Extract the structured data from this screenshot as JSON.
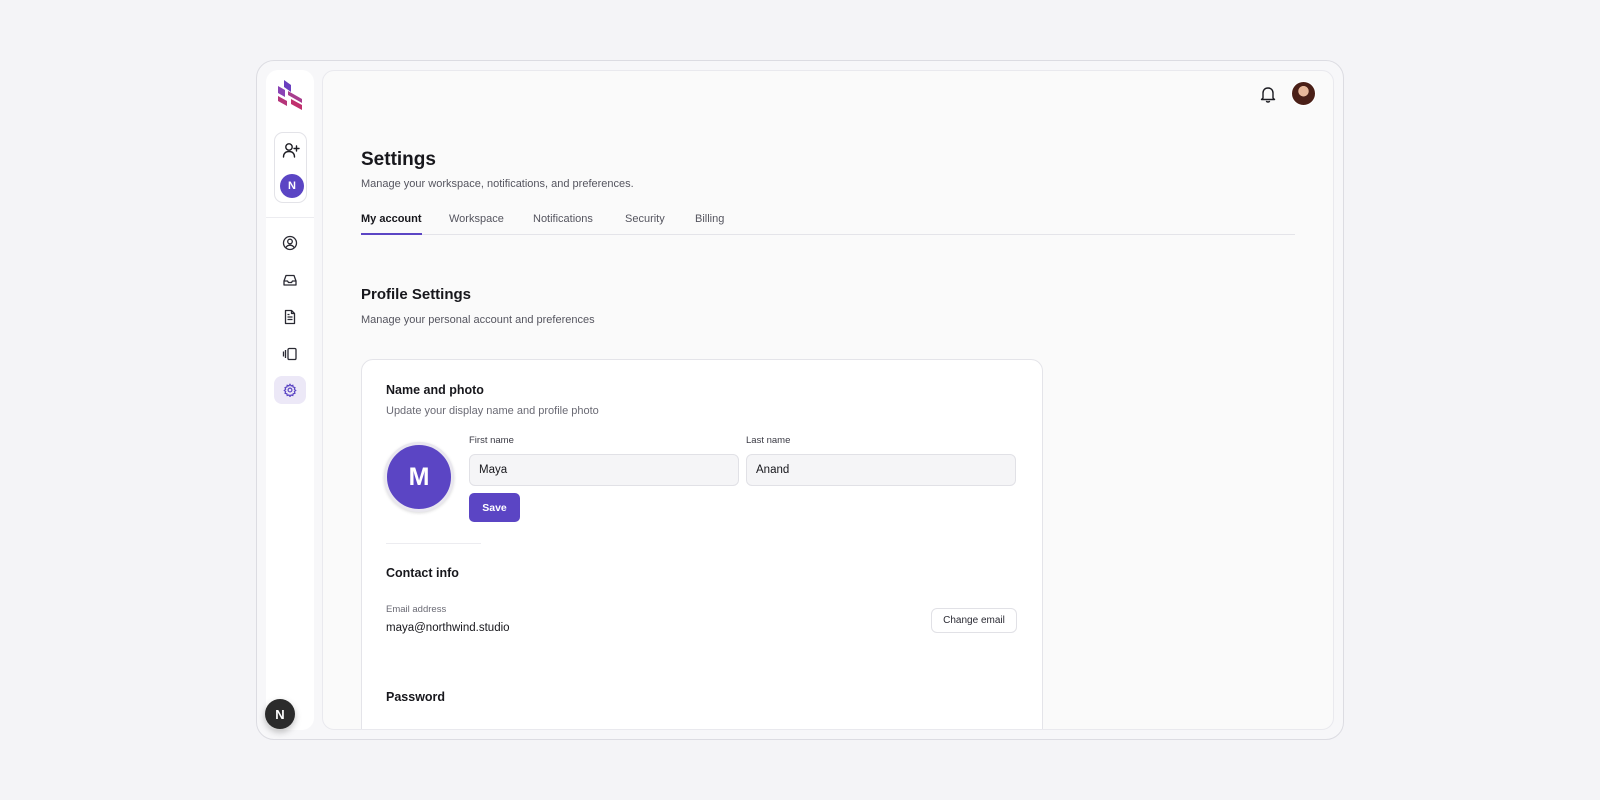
{
  "sidebar": {
    "workspace_initial": "N",
    "bottom_badge": "N",
    "nav": [
      {
        "icon": "user-circle-icon",
        "active": false
      },
      {
        "icon": "inbox-icon",
        "active": false
      },
      {
        "icon": "document-icon",
        "active": false
      },
      {
        "icon": "gallery-icon",
        "active": false
      },
      {
        "icon": "gear-icon",
        "active": true
      }
    ]
  },
  "header": {
    "title": "Settings",
    "subtitle": "Manage your workspace, notifications, and preferences."
  },
  "tabs": [
    {
      "label": "My account",
      "active": true
    },
    {
      "label": "Workspace",
      "active": false
    },
    {
      "label": "Notifications",
      "active": false
    },
    {
      "label": "Security",
      "active": false
    },
    {
      "label": "Billing",
      "active": false
    }
  ],
  "profile": {
    "title": "Profile Settings",
    "subtitle": "Manage your personal account and preferences"
  },
  "name_photo": {
    "title": "Name and photo",
    "subtitle": "Update your display name and profile photo",
    "avatar_initial": "M",
    "first_name_label": "First name",
    "first_name_value": "Maya",
    "last_name_label": "Last name",
    "last_name_value": "Anand",
    "save_label": "Save"
  },
  "contact": {
    "title": "Contact info",
    "email_label": "Email address",
    "email_value": "maya@northwind.studio",
    "change_email_label": "Change email"
  },
  "password": {
    "title": "Password"
  },
  "colors": {
    "accent": "#5b45c4",
    "background": "#f4f4f7",
    "bottom_badge": "#2b2b2b"
  }
}
